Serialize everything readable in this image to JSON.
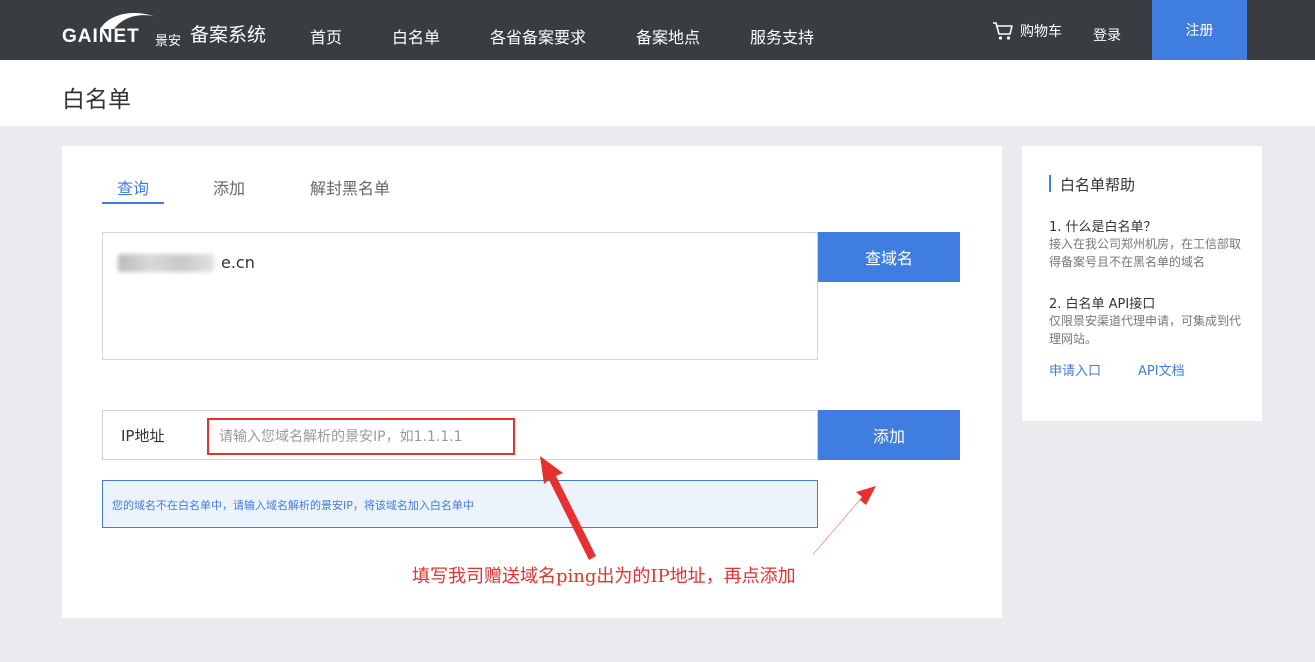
{
  "brand": {
    "logo_text": "GAINET",
    "logo_sub": "景安",
    "system_name": "备案系统"
  },
  "nav": {
    "items": [
      {
        "label": "首页"
      },
      {
        "label": "白名单"
      },
      {
        "label": "各省备案要求"
      },
      {
        "label": "备案地点"
      },
      {
        "label": "服务支持"
      }
    ],
    "cart_label": "购物车",
    "login_label": "登录",
    "register_label": "注册"
  },
  "page": {
    "title": "白名单"
  },
  "tabs": [
    {
      "label": "查询",
      "active": true
    },
    {
      "label": "添加",
      "active": false
    },
    {
      "label": "解封黑名单",
      "active": false
    }
  ],
  "query": {
    "domain_value": "e.cn",
    "query_button": "查域名"
  },
  "ip_form": {
    "label": "IP地址",
    "placeholder": "请输入您域名解析的景安IP，如1.1.1.1",
    "add_button": "添加",
    "tip": "您的域名不在白名单中，请输入域名解析的景安IP，将该域名加入白名单中"
  },
  "annotation": {
    "text": "填写我司赠送域名ping出为的IP地址，再点添加",
    "color": "#e5312f"
  },
  "help": {
    "title": "白名单帮助",
    "items": [
      {
        "question": "1. 什么是白名单？",
        "answer": "接入在我公司郑州机房，在工信部取得备案号且不在黑名单的域名"
      },
      {
        "question": "2. 白名单 API接口",
        "answer": "仅限景安渠道代理申请，可集成到代理网站。"
      }
    ],
    "links": [
      {
        "label": "申请入口"
      },
      {
        "label": "API文档"
      }
    ]
  },
  "colors": {
    "accent": "#3f7de0",
    "topbar": "#393d42",
    "background": "#e9ebee"
  }
}
